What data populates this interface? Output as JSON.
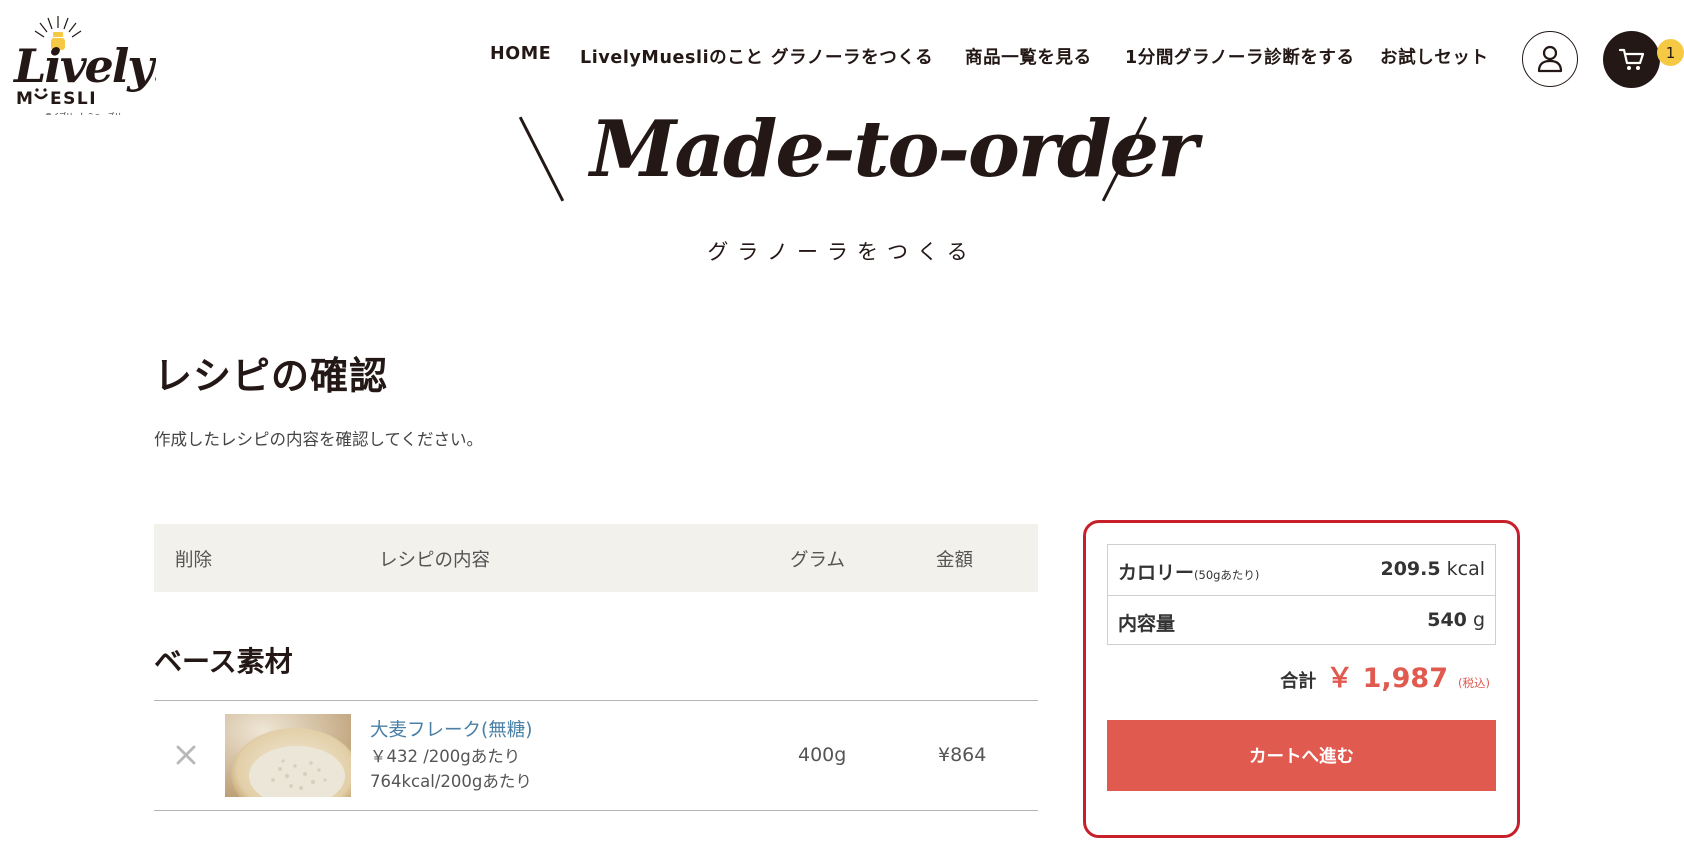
{
  "brand": {
    "logo_word": "Lively!",
    "logo_sub": "MUESLI",
    "logo_kana": "ライブリー！ミューズリー"
  },
  "nav": {
    "items": [
      "HOME",
      "LivelyMuesliのこと",
      "グラノーラをつくる",
      "商品一覧を見る",
      "1分間グラノーラ診断をする",
      "お試しセット"
    ],
    "user_icon": "user-icon",
    "cart_icon": "cart-icon",
    "cart_count": "1"
  },
  "hero": {
    "title": "Made-to-order",
    "subtitle": "グラノーラをつくる"
  },
  "page": {
    "title": "レシピの確認",
    "description": "作成したレシピの内容を確認してください。"
  },
  "table": {
    "headers": [
      "削除",
      "レシピの内容",
      "グラム",
      "金額"
    ],
    "section_title": "ベース素材",
    "rows": [
      {
        "delete_icon": "close-icon",
        "name": "大麦フレーク(無糖)",
        "price_line": "￥432 /200gあたり",
        "kcal_line": "764kcal/200gあたり",
        "gram": "400g",
        "amount": "¥864"
      }
    ]
  },
  "summary": {
    "calorie_label": "カロリー",
    "calorie_note": "(50gあたり)",
    "calorie_value": "209.5",
    "calorie_unit": "kcal",
    "volume_label": "内容量",
    "volume_value": "540",
    "volume_unit": "g",
    "total_label": "合計",
    "total_amount": "￥ 1,987",
    "total_tax": "(税込)",
    "cta_label": "カートへ進む"
  },
  "colors": {
    "text": "#231815",
    "accent": "#e05a50",
    "link": "#4a80a6",
    "highlight_border": "#c8202a",
    "table_head_bg": "#f2f1ec",
    "badge": "#f6c945"
  }
}
